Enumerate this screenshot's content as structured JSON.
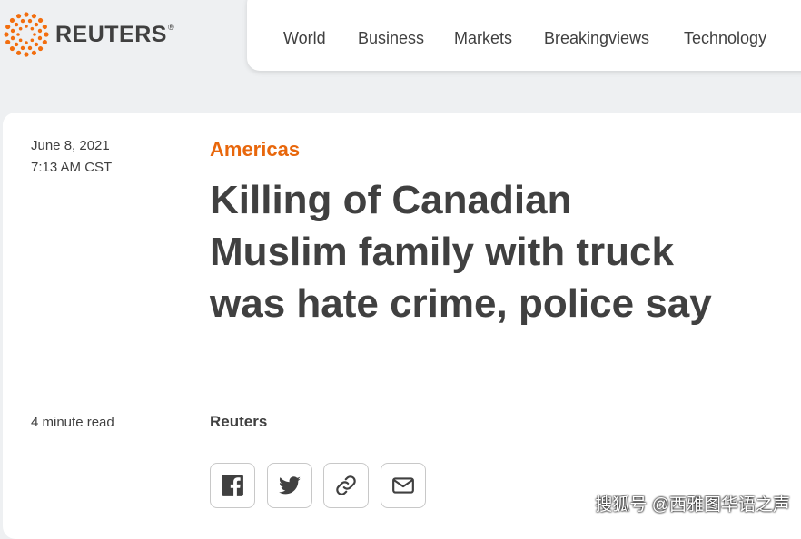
{
  "brand": {
    "name": "REUTERS",
    "mark": "®"
  },
  "nav": [
    "World",
    "Business",
    "Markets",
    "Breakingviews",
    "Technology"
  ],
  "article": {
    "date": "June 8, 2021",
    "time": "7:13 AM CST",
    "section": "Americas",
    "headline": "Killing of Canadian Muslim family with truck was hate crime, police say",
    "read_time": "4 minute read",
    "byline": "Reuters"
  },
  "share_icons": [
    "facebook-icon",
    "twitter-icon",
    "link-icon",
    "email-icon"
  ],
  "watermark": "搜狐号 @西雅图华语之声",
  "colors": {
    "accent": "#e8670c",
    "text": "#404040",
    "logo": "#f26e0f"
  }
}
